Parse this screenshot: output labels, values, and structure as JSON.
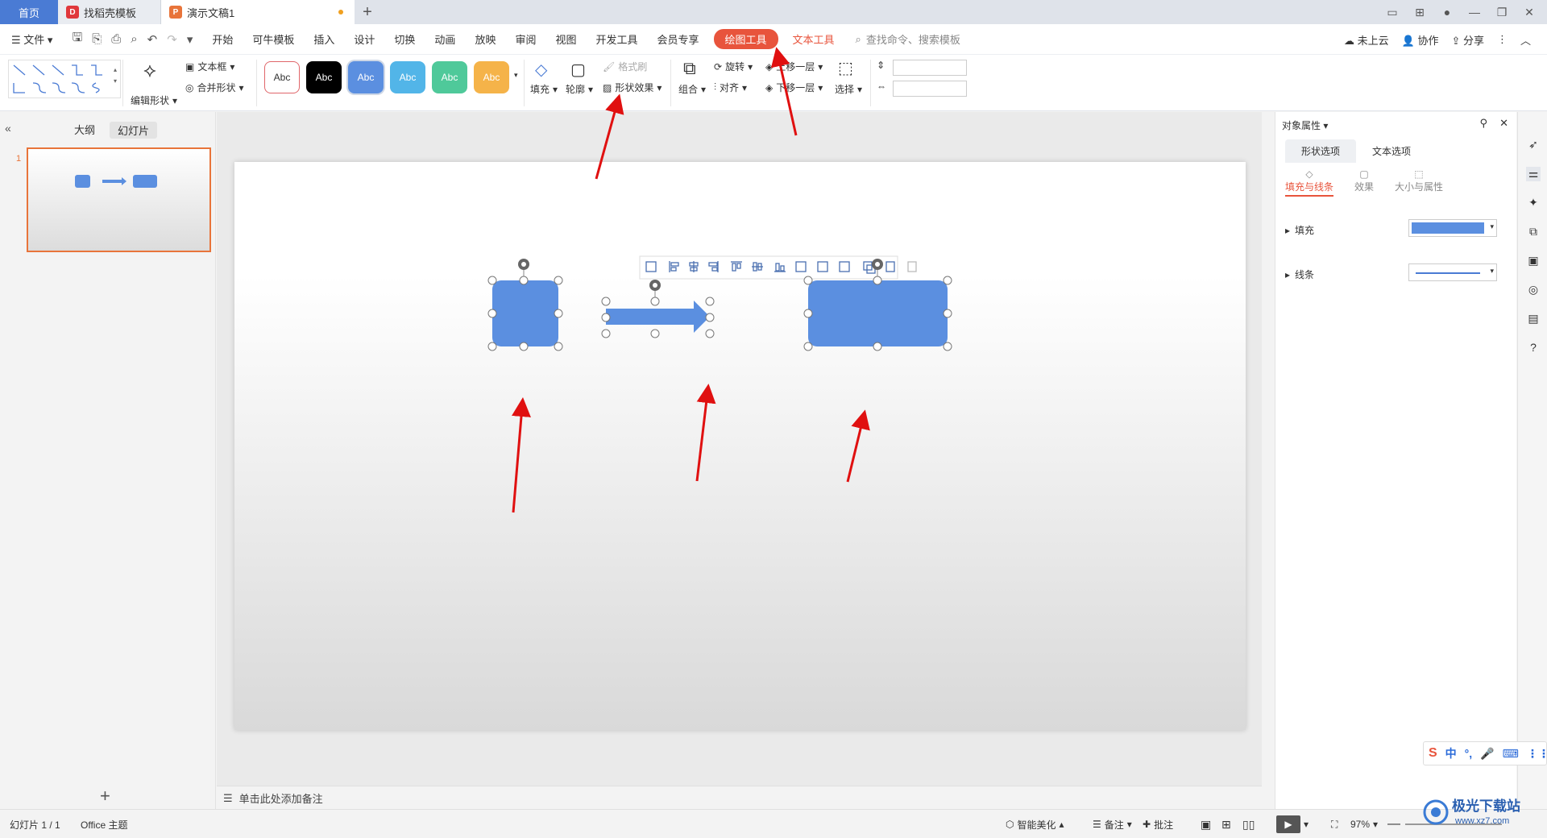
{
  "tabs": [
    {
      "label": "首页"
    },
    {
      "label": "找稻壳模板"
    },
    {
      "label": "演示文稿1"
    }
  ],
  "menu": {
    "file": "文件",
    "items": [
      "开始",
      "可牛模板",
      "插入",
      "设计",
      "切换",
      "动画",
      "放映",
      "审阅",
      "视图",
      "开发工具",
      "会员专享"
    ],
    "active_tool": "绘图工具",
    "text_tool": "文本工具",
    "search": "查找命令、搜索模板",
    "right": {
      "cloud": "未上云",
      "collab": "协作",
      "share": "分享"
    }
  },
  "ribbon": {
    "edit_shape": "编辑形状",
    "text_box": "文本框",
    "merge_shape": "合并形状",
    "swatches": [
      "Abc",
      "Abc",
      "Abc",
      "Abc",
      "Abc",
      "Abc"
    ],
    "fill": "填充",
    "outline": "轮廓",
    "format_painter": "格式刷",
    "shape_effect": "形状效果",
    "group": "组合",
    "rotate": "旋转",
    "align": "对齐",
    "bring_forward": "上移一层",
    "send_backward": "下移一层",
    "select": "选择"
  },
  "left_panel": {
    "outline": "大纲",
    "slides": "幻灯片",
    "slide_number": "1"
  },
  "notes": "单击此处添加备注",
  "right_panel": {
    "title": "对象属性",
    "tab_shape": "形状选项",
    "tab_text": "文本选项",
    "sub_fill_line": "填充与线条",
    "sub_effect": "效果",
    "sub_size": "大小与属性",
    "fill": "填充",
    "line": "线条"
  },
  "status": {
    "slide": "幻灯片 1 / 1",
    "theme": "Office 主题",
    "beautify": "智能美化",
    "notes": "备注",
    "comments": "批注",
    "zoom": "97%"
  },
  "ime": {
    "lang": "中"
  },
  "watermark": {
    "text": "极光下载站",
    "url": "www.xz7.com"
  },
  "colors": {
    "accent": "#e8543c",
    "shape_fill": "#5b8fe0",
    "arrow": "#e01010"
  }
}
